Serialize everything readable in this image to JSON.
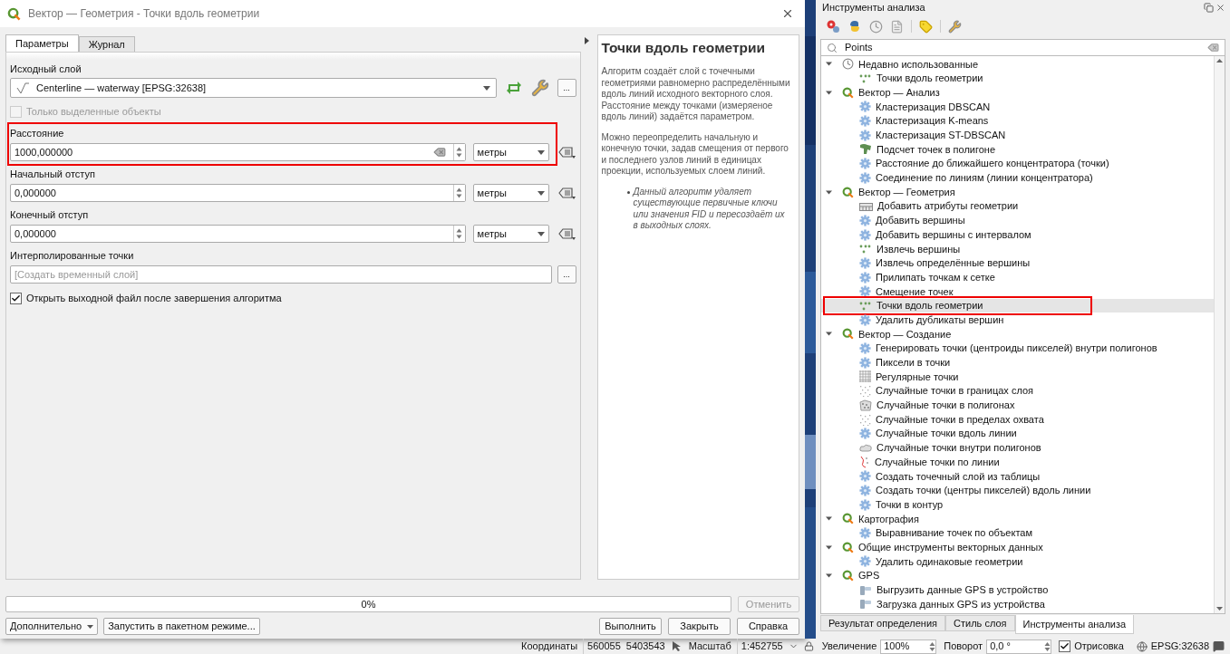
{
  "dialog": {
    "title": "Вектор — Геометрия - Точки вдоль геометрии",
    "tabs": [
      {
        "label": "Параметры",
        "selected": true
      },
      {
        "label": "Журнал",
        "selected": false
      }
    ],
    "parameters": [
      {
        "kind": "layer",
        "label": "Исходный слой",
        "value": "Centerline — waterway [EPSG:32638]",
        "button": "...",
        "annotated": false
      },
      {
        "kind": "checkbox",
        "label": "Только выделенные объекты",
        "checked": false,
        "disabled": true,
        "annotated": false
      },
      {
        "kind": "distance",
        "label": "Расстояние",
        "value": "1000,000000",
        "unit": "метры",
        "clearable": true,
        "annotated": true
      },
      {
        "kind": "distance",
        "label": "Начальный отступ",
        "value": "0,000000",
        "unit": "метры",
        "clearable": false,
        "annotated": false
      },
      {
        "kind": "distance",
        "label": "Конечный отступ",
        "value": "0,000000",
        "unit": "метры",
        "clearable": false,
        "annotated": false
      },
      {
        "kind": "output",
        "label": "Интерполированные точки",
        "placeholder": "[Создать временный слой]",
        "button": "...",
        "annotated": false
      },
      {
        "kind": "checkbox",
        "label": "Открыть выходной файл после завершения алгоритма",
        "checked": true,
        "disabled": false,
        "annotated": false
      }
    ],
    "help": {
      "title": "Точки вдоль геометрии",
      "paragraphs": [
        "Алгоритм создаёт слой с точечными геометриями равномерно распределёнными вдоль линий исходного векторного слоя. Расстояние между точками (измеряеное вдоль линий) задаётся параметром.",
        "Можно переопределить начальную и конечную точки, задав смещения от первого и последнего узлов линий в единицах проекции, используемых слоем линий."
      ],
      "notes": [
        "Данный алгоритм удаляет существующие первичные ключи или значения FID и пересоздаёт их в выходных слоях."
      ]
    },
    "progress": {
      "level": 0,
      "label": "0%"
    },
    "cancel": {
      "label": "Отменить",
      "disabled": true
    },
    "left_buttons": [
      {
        "label": "Дополнительно",
        "dropdown": true
      },
      {
        "label": "Запустить в пакетном режиме...",
        "dropdown": false
      }
    ],
    "right_buttons": [
      "Выполнить",
      "Закрыть",
      "Справка"
    ]
  },
  "status_bar": {
    "coordinates_label": "Координаты",
    "coordinates": "560055  5403543",
    "scale_label": "Масштаб",
    "scale": "1:452755",
    "magnifier_label": "Увеличение",
    "magnifier": "100%",
    "rotation_label": "Поворот",
    "rotation": "0,0 °",
    "render": {
      "label": "Отрисовка",
      "checked": true
    },
    "crs": "EPSG:32638"
  },
  "toolbox": {
    "title": "Инструменты анализа",
    "search": "Points",
    "tree": [
      {
        "label": "Недавно использованные",
        "kind": "recent",
        "expanded": true,
        "selected": false,
        "children": [
          {
            "label": "Точки вдоль геометрии",
            "kind": "points",
            "selected": false,
            "annotated": false
          }
        ]
      },
      {
        "label": "Вектор — Анализ",
        "kind": "provider",
        "expanded": true,
        "selected": false,
        "children": [
          {
            "label": "Кластеризация DBSCAN",
            "kind": "gear",
            "selected": false,
            "annotated": false
          },
          {
            "label": "Кластеризация K-means",
            "kind": "gear",
            "selected": false,
            "annotated": false
          },
          {
            "label": "Кластеризация ST-DBSCAN",
            "kind": "gear",
            "selected": false,
            "annotated": false
          },
          {
            "label": "Подсчет точек в полигоне",
            "kind": "count",
            "selected": false,
            "annotated": false
          },
          {
            "label": "Расстояние до ближайшего концентратора (точки)",
            "kind": "gear",
            "selected": false,
            "annotated": false
          },
          {
            "label": "Соединение по линиям (линии концентратора)",
            "kind": "gear",
            "selected": false,
            "annotated": false
          }
        ]
      },
      {
        "label": "Вектор — Геометрия",
        "kind": "provider",
        "expanded": true,
        "selected": false,
        "children": [
          {
            "label": "Добавить атрибуты геометрии",
            "kind": "table",
            "selected": false,
            "annotated": false
          },
          {
            "label": "Добавить вершины",
            "kind": "gear",
            "selected": false,
            "annotated": false
          },
          {
            "label": "Добавить вершины с интервалом",
            "kind": "gear",
            "selected": false,
            "annotated": false
          },
          {
            "label": "Извлечь вершины",
            "kind": "points",
            "selected": false,
            "annotated": false
          },
          {
            "label": "Извлечь определённые вершины",
            "kind": "gear",
            "selected": false,
            "annotated": false
          },
          {
            "label": "Прилипать точкам к сетке",
            "kind": "gear",
            "selected": false,
            "annotated": false
          },
          {
            "label": "Смещение точек",
            "kind": "gear",
            "selected": false,
            "annotated": false
          },
          {
            "label": "Точки вдоль геометрии",
            "kind": "points",
            "selected": true,
            "annotated": true
          },
          {
            "label": "Удалить дубликаты вершин",
            "kind": "gear",
            "selected": false,
            "annotated": false
          }
        ]
      },
      {
        "label": "Вектор — Создание",
        "kind": "provider",
        "expanded": true,
        "selected": false,
        "children": [
          {
            "label": "Генерировать точки (центроиды пикселей) внутри полигонов",
            "kind": "gear",
            "selected": false,
            "annotated": false
          },
          {
            "label": "Пиксели в точки",
            "kind": "gear",
            "selected": false,
            "annotated": false
          },
          {
            "label": "Регулярные точки",
            "kind": "grid",
            "selected": false,
            "annotated": false
          },
          {
            "label": "Случайные точки в границах слоя",
            "kind": "scatter",
            "selected": false,
            "annotated": false
          },
          {
            "label": "Случайные точки в полигонах",
            "kind": "polygon",
            "selected": false,
            "annotated": false
          },
          {
            "label": "Случайные точки в пределах охвата",
            "kind": "scatter",
            "selected": false,
            "annotated": false
          },
          {
            "label": "Случайные точки вдоль линии",
            "kind": "gear",
            "selected": false,
            "annotated": false
          },
          {
            "label": "Случайные точки внутри полигонов",
            "kind": "cloud",
            "selected": false,
            "annotated": false
          },
          {
            "label": "Случайные точки по линии",
            "kind": "line",
            "selected": false,
            "annotated": false
          },
          {
            "label": "Создать точечный слой из таблицы",
            "kind": "gear",
            "selected": false,
            "annotated": false
          },
          {
            "label": "Создать точки (центры пикселей) вдоль линии",
            "kind": "gear",
            "selected": false,
            "annotated": false
          },
          {
            "label": "Точки в контур",
            "kind": "gear",
            "selected": false,
            "annotated": false
          }
        ]
      },
      {
        "label": "Картография",
        "kind": "provider",
        "expanded": true,
        "selected": false,
        "children": [
          {
            "label": "Выравнивание точек по объектам",
            "kind": "gear",
            "selected": false,
            "annotated": false
          }
        ]
      },
      {
        "label": "Общие инструменты векторных данных",
        "kind": "provider",
        "expanded": true,
        "selected": false,
        "children": [
          {
            "label": "Удалить одинаковые геометрии",
            "kind": "gear",
            "selected": false,
            "annotated": false
          }
        ]
      },
      {
        "label": "GPS",
        "kind": "provider",
        "expanded": true,
        "selected": false,
        "children": [
          {
            "label": "Выгрузить данные GPS в устройство",
            "kind": "gps",
            "selected": false,
            "annotated": false
          },
          {
            "label": "Загрузка данных GPS из устройства",
            "kind": "gps",
            "selected": false,
            "annotated": false
          }
        ]
      }
    ],
    "dock_tabs": [
      {
        "label": "Результат определения",
        "selected": false
      },
      {
        "label": "Стиль слоя",
        "selected": false
      },
      {
        "label": "Инструменты анализа",
        "selected": true
      }
    ]
  }
}
